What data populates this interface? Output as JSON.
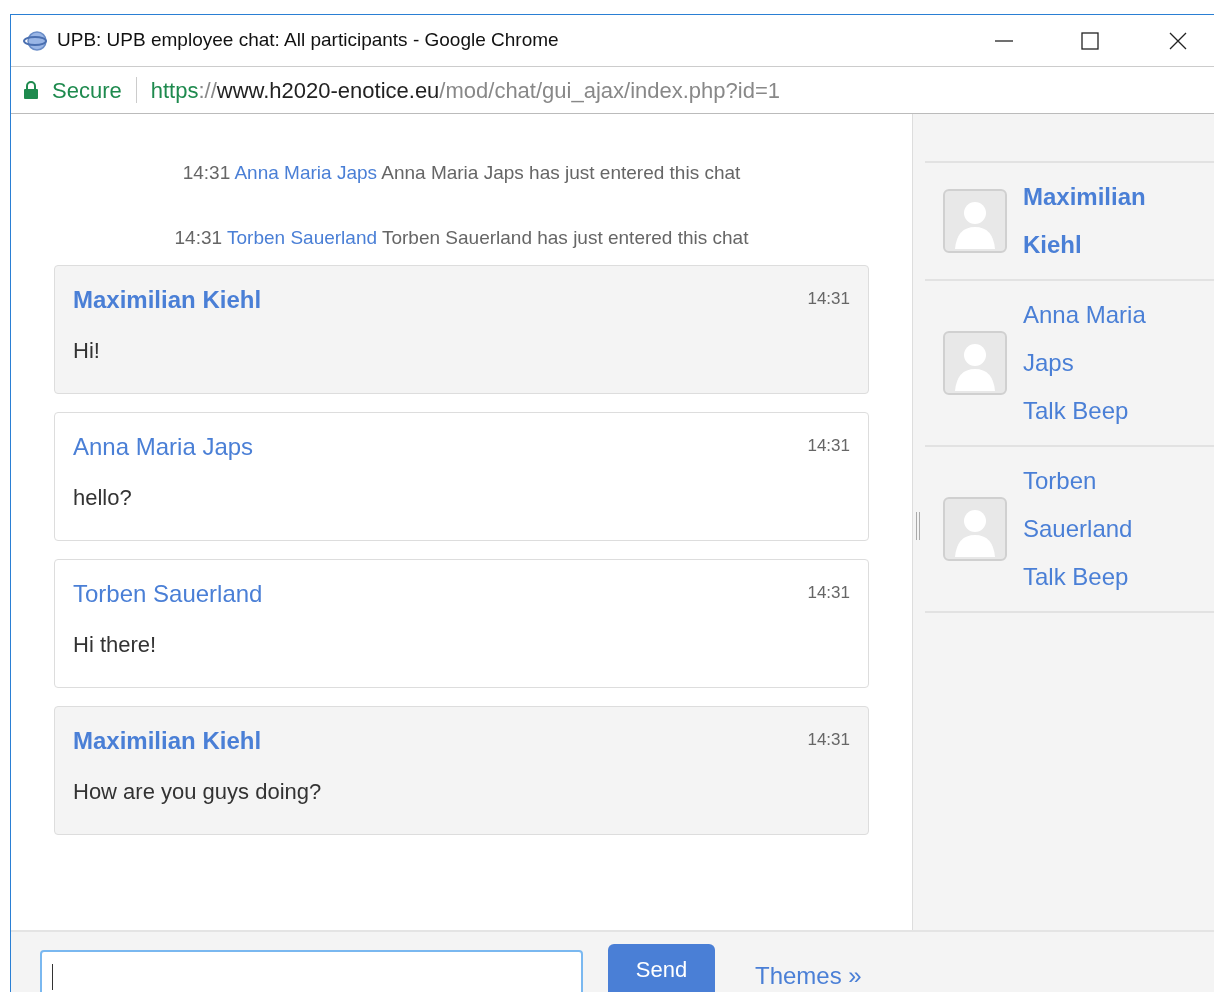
{
  "window": {
    "title": "UPB: UPB employee chat: All participants - Google Chrome"
  },
  "address_bar": {
    "security": "Secure",
    "url_parts": [
      {
        "kind": "scheme",
        "text": "https"
      },
      {
        "kind": "sep",
        "text": "://"
      },
      {
        "kind": "host",
        "text": "www.h2020-enotice.eu"
      },
      {
        "kind": "path",
        "text": "/mod/chat/gui_ajax/index.php?id=1"
      }
    ]
  },
  "events": [
    {
      "time": "14:31",
      "user": "Anna Maria Japs",
      "text": "Anna Maria Japs has just entered this chat"
    },
    {
      "time": "14:31",
      "user": "Torben Sauerland",
      "text": "Torben Sauerland has just entered this chat"
    }
  ],
  "messages": [
    {
      "author": "Maximilian Kiehl",
      "time": "14:31",
      "text": "Hi!",
      "own": true
    },
    {
      "author": "Anna Maria Japs",
      "time": "14:31",
      "text": "hello?",
      "own": false
    },
    {
      "author": "Torben Sauerland",
      "time": "14:31",
      "text": "Hi there!",
      "own": false
    },
    {
      "author": "Maximilian Kiehl",
      "time": "14:31",
      "text": "How are you guys doing?",
      "own": true
    }
  ],
  "users": [
    {
      "name_lines": [
        "Maximilian",
        "Kiehl"
      ],
      "self": true
    },
    {
      "name_lines": [
        "Anna Maria",
        "Japs"
      ],
      "self": false,
      "beep": "Talk Beep"
    },
    {
      "name_lines": [
        "Torben",
        "Sauerland"
      ],
      "self": false,
      "beep": "Talk Beep"
    }
  ],
  "composer": {
    "send": "Send",
    "themes": "Themes »"
  }
}
